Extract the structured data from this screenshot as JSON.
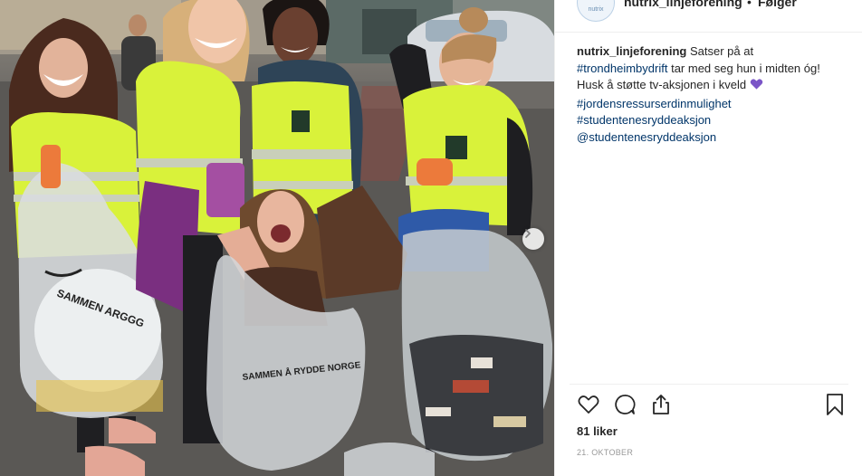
{
  "post": {
    "header_username": "nutrix_linjeforening",
    "header_separator": "•",
    "header_follow": "Følger",
    "avatar_text": "nutrix",
    "caption_username": "nutrix_linjeforening",
    "caption_line1": "Satser på at",
    "hashtag1": "#trondheimbydrift",
    "caption_text2": "tar med seg hun i midten óg! Husk å støtte tv-aksjonen i kveld",
    "hashtag2": "#jordensressurserdinmulighet",
    "hashtag3": "#studentenesryddeaksjon",
    "mention1": "@studentenesryddeaksjon",
    "likes": "81 liker",
    "date": "21. OKTOBER"
  },
  "photo": {
    "bag_text_left": "SAMMEN ARGGG",
    "bag_text_center": "SAMMEN Å RYDDE NORGE"
  },
  "colors": {
    "link": "#003569",
    "text": "#262626",
    "muted": "#999999",
    "vest": "#d9f23a",
    "heart_emoji": "#7b55c7"
  },
  "icons": {
    "like": "heart-outline-icon",
    "comment": "comment-bubble-icon",
    "share": "share-icon",
    "save": "bookmark-icon",
    "next": "chevron-right-icon"
  }
}
